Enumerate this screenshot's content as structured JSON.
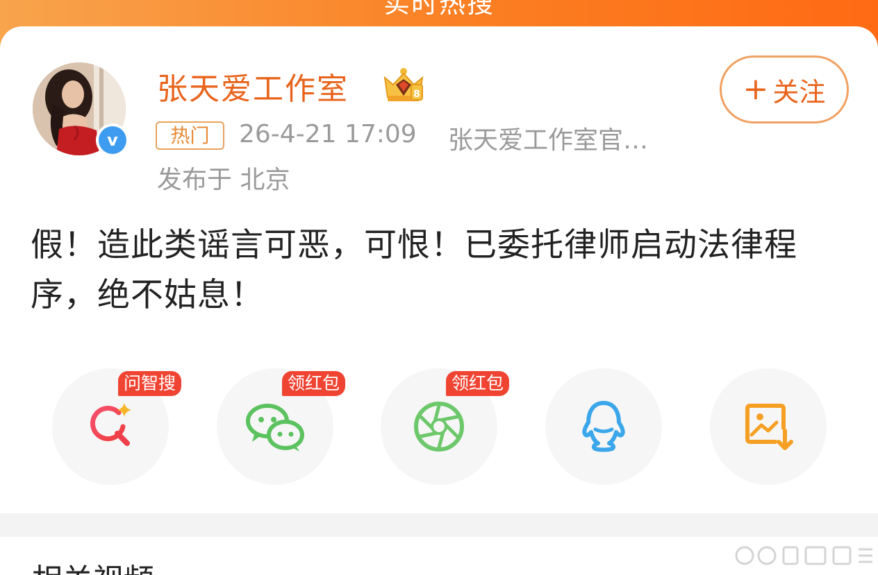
{
  "header": {
    "title": "实时热搜"
  },
  "user": {
    "name": "张天爱工作室",
    "verified_icon": "verified-v-icon",
    "badge_icon": "vip-crown-icon"
  },
  "follow": {
    "plus": "+",
    "label": "关注"
  },
  "meta": {
    "tag": "热门",
    "time": "26-4-21 17:09",
    "source": "张天爱工作室官…",
    "location": "发布于 北京"
  },
  "post": {
    "text": "假！造此类谣言可恶，可恨！已委托律师启动法律程序，绝不姑息！"
  },
  "share": {
    "items": [
      {
        "icon": "ai-search-icon",
        "tag": "问智搜",
        "color": "#f0445a"
      },
      {
        "icon": "wechat-icon",
        "tag": "领红包",
        "color": "#5bc25f"
      },
      {
        "icon": "moments-icon",
        "tag": "领红包",
        "color": "#6cc86a"
      },
      {
        "icon": "qq-icon",
        "tag": "",
        "color": "#3ba6ea"
      },
      {
        "icon": "save-image-icon",
        "tag": "",
        "color": "#f5a024"
      }
    ]
  },
  "related": {
    "title": "相关视频"
  },
  "colors": {
    "accent": "#e8641c",
    "banner": "#fb7e22",
    "tag_red": "#f04433",
    "muted_text": "#9a9a9a"
  }
}
